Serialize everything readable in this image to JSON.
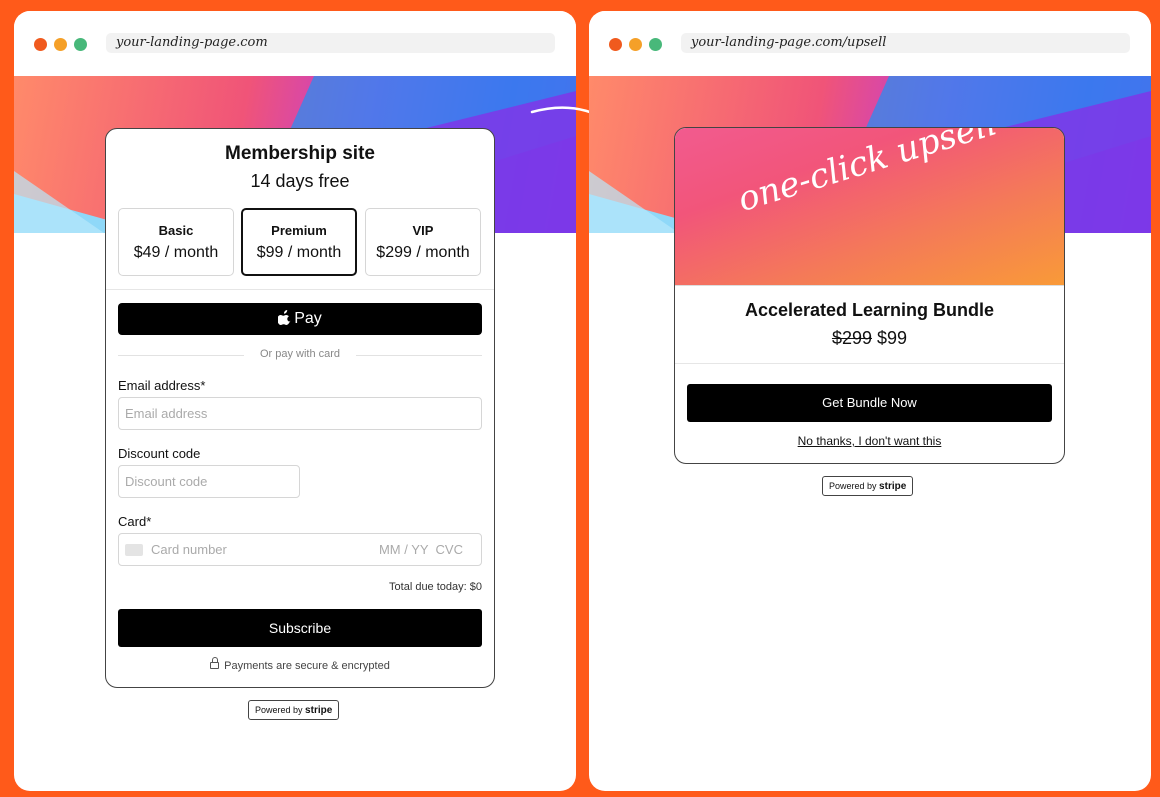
{
  "colors": {
    "background": "#ff5a1a",
    "traffic_red": "#f05a1e",
    "traffic_yellow": "#f5a028",
    "traffic_green": "#48b87a",
    "button": "#000000"
  },
  "left_window": {
    "url": "your-landing-page.com",
    "card": {
      "title": "Membership site",
      "subtitle": "14 days free",
      "plans": [
        {
          "name": "Basic",
          "price": "$49 / month",
          "selected": false
        },
        {
          "name": "Premium",
          "price": "$99 / month",
          "selected": true
        },
        {
          "name": "VIP",
          "price": "$299 / month",
          "selected": false
        }
      ],
      "apple_pay_label": "Pay",
      "or_pay_text": "Or pay with card",
      "email_label": "Email address",
      "email_placeholder": "Email address",
      "discount_label": "Discount code",
      "discount_placeholder": "Discount code",
      "card_label": "Card",
      "card_number_placeholder": "Card number",
      "card_expiry_cvc_placeholder": "MM / YY  CVC",
      "required_mark": "*",
      "total_text": "Total due today: $0",
      "subscribe_label": "Subscribe",
      "secure_text": "Payments are secure & encrypted"
    },
    "powered_by": "Powered by",
    "powered_brand": "stripe"
  },
  "right_window": {
    "url": "your-landing-page.com/upsell",
    "card": {
      "image_text": "one-click upsell",
      "title": "Accelerated Learning Bundle",
      "old_price": "$299",
      "new_price": "$99",
      "cta_label": "Get Bundle Now",
      "decline_label": "No thanks, I don't want this"
    },
    "powered_by": "Powered by",
    "powered_brand": "stripe"
  }
}
